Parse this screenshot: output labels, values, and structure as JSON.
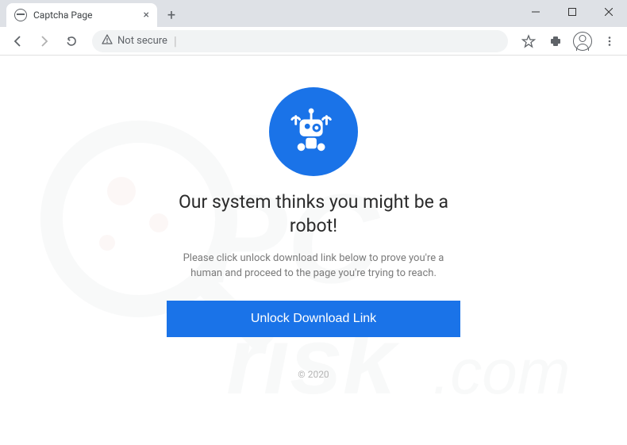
{
  "tab": {
    "title": "Captcha Page"
  },
  "address": {
    "warning": "Not secure"
  },
  "content": {
    "headline": "Our system thinks you might be a robot!",
    "subtext": "Please click unlock download link below to prove you're a human and proceed to the page you're trying to reach.",
    "button_label": "Unlock Download Link",
    "copyright": "© 2020"
  },
  "colors": {
    "accent": "#1a73e8"
  }
}
